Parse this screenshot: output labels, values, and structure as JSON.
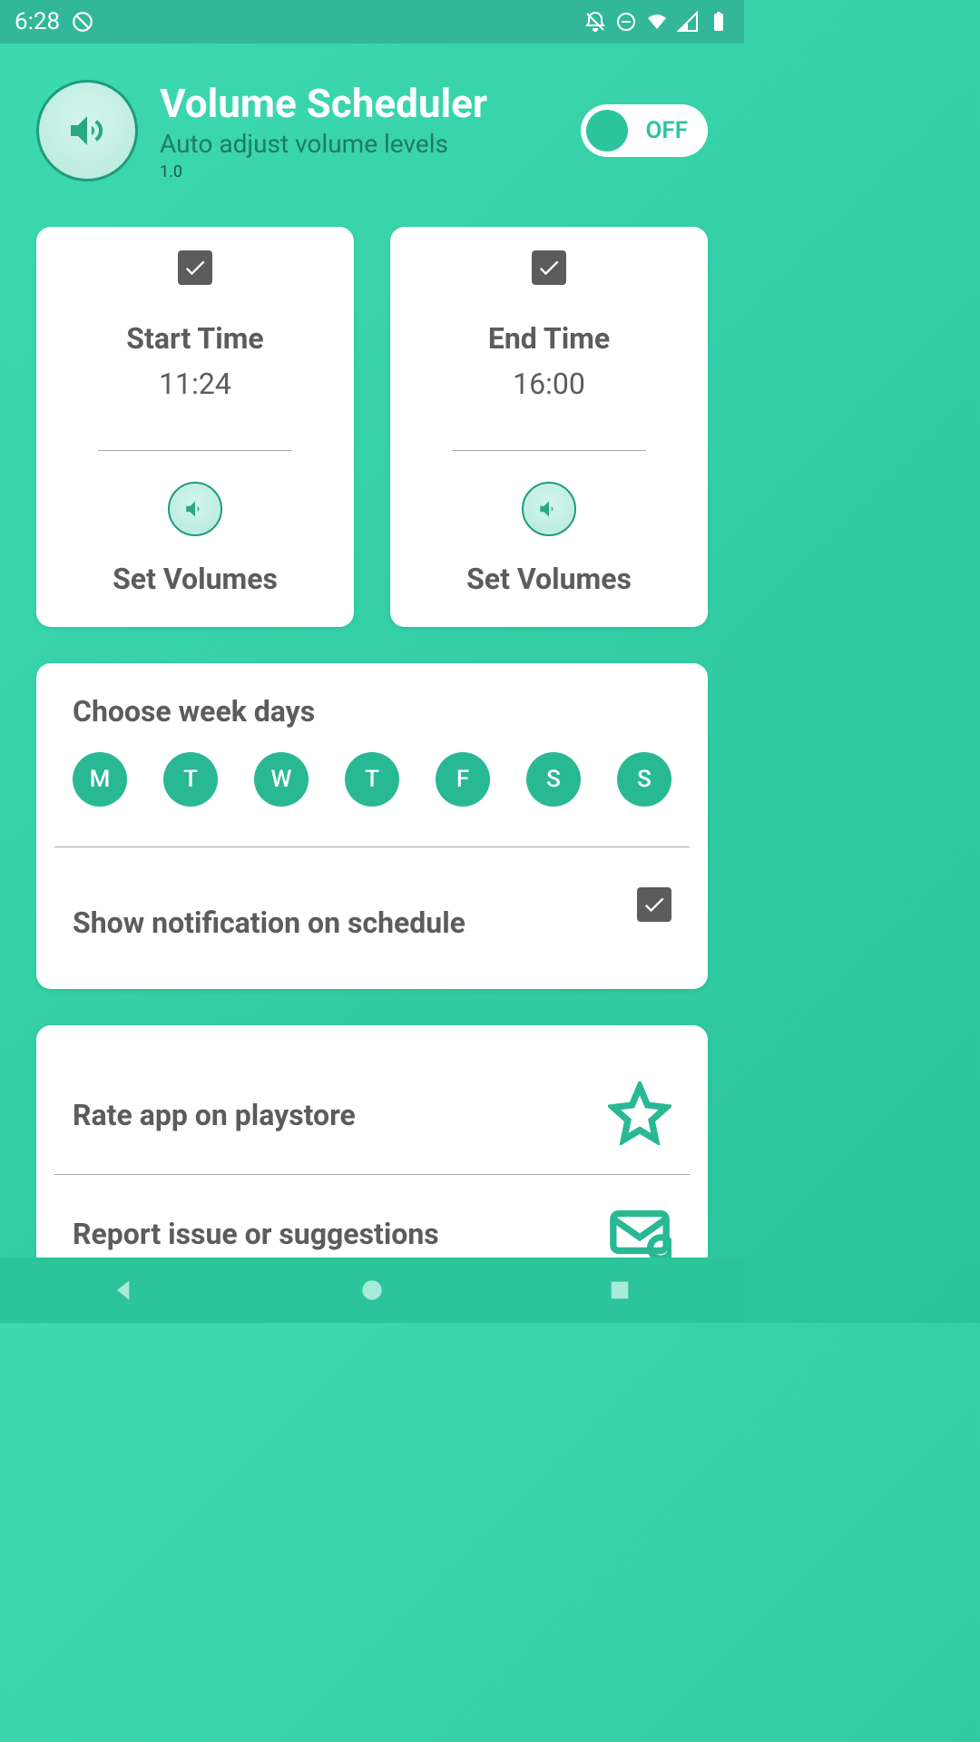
{
  "status": {
    "time": "6:28"
  },
  "header": {
    "title": "Volume Scheduler",
    "subtitle": "Auto adjust volume levels",
    "version": "1.0",
    "toggle_label": "OFF"
  },
  "start_card": {
    "title": "Start Time",
    "time": "11:24",
    "set_label": "Set Volumes"
  },
  "end_card": {
    "title": "End Time",
    "time": "16:00",
    "set_label": "Set Volumes"
  },
  "days_section": {
    "title": "Choose week days",
    "days": [
      "M",
      "T",
      "W",
      "T",
      "F",
      "S",
      "S"
    ],
    "notif_label": "Show notification on schedule"
  },
  "info": {
    "rate_label": "Rate app on playstore",
    "report_label": "Report issue or suggestions"
  }
}
